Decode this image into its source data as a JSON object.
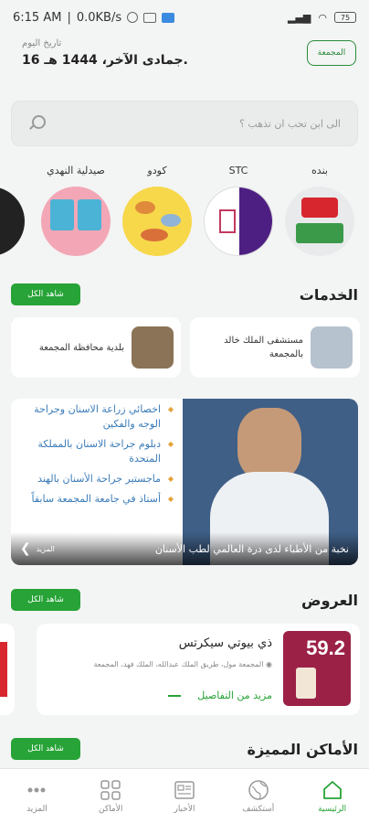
{
  "status": {
    "time": "6:15 AM",
    "speed": "0.0KB/s",
    "battery": "75"
  },
  "header": {
    "date_label": "تاريخ اليوم",
    "date_value": "16 جمادى الآخر، 1444 هـ.",
    "logo_text": "المجمعة"
  },
  "search": {
    "placeholder": "الى اين تحب ان تذهب ؟"
  },
  "stores": [
    {
      "name": "صيدلية النهدي"
    },
    {
      "name": "كودو"
    },
    {
      "name": "STC"
    },
    {
      "name": "بنده"
    }
  ],
  "services": {
    "title": "الخدمات",
    "see_all": "شاهد الكل",
    "items": [
      {
        "label": "بلدية محافظة المجمعة"
      },
      {
        "label": "مستشفى الملك خالد بالمجمعة"
      }
    ]
  },
  "banner": {
    "lines": [
      "اخصائي زراعة الاسنان وجراحة الوجه والفكين",
      "دبلوم جراحة الاسنان بالمملكة المتحدة",
      "ماجستير جراحة الأسنان بالهند",
      "أستاذ في جامعة المجمعة سابقاً"
    ],
    "caption": "نخبة من الأطباء لدى درة العالمي لطب الأسنان",
    "more": "المزيد"
  },
  "offers": {
    "title": "العروض",
    "see_all": "شاهد الكل",
    "item": {
      "title": "ذي بيوتي سيكرتس",
      "address": "المجمعة مول، طريق الملك عبدالله، الملك فهد، المجمعة",
      "details_link": "مزيد من التفاصيل",
      "badge": "59.2"
    }
  },
  "featured": {
    "title": "الأماكن المميزة",
    "see_all": "شاهد الكل"
  },
  "nav": [
    {
      "label": "المزيد",
      "icon": "more-icon"
    },
    {
      "label": "الأماكن",
      "icon": "grid-icon"
    },
    {
      "label": "الأخبار",
      "icon": "news-icon"
    },
    {
      "label": "أستكشف",
      "icon": "globe-icon"
    },
    {
      "label": "الرئيسية",
      "icon": "home-icon"
    }
  ],
  "colors": {
    "accent": "#27a337",
    "banner_blue": "#3f5f86",
    "background": "#f3f4f4"
  }
}
